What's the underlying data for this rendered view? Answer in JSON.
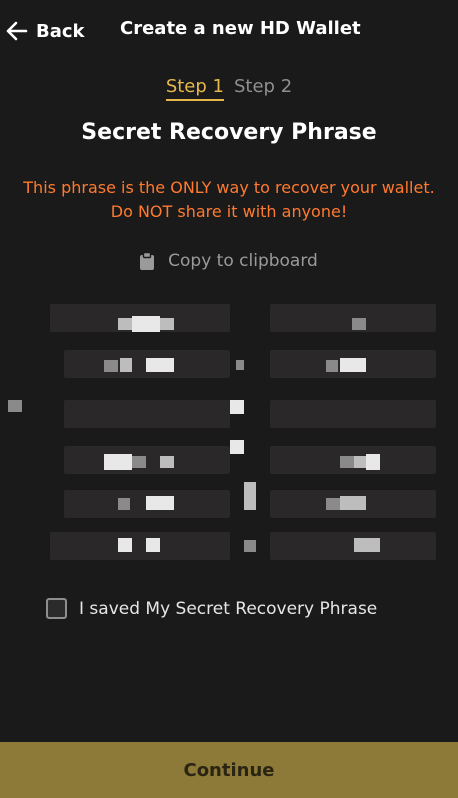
{
  "header": {
    "back_label": "Back",
    "title": "Create a new HD Wallet"
  },
  "steps": {
    "step1": "Step 1",
    "step2": "Step 2",
    "active": 1
  },
  "heading": "Secret Recovery Phrase",
  "warning": "This phrase is the ONLY way to recover your wallet. Do NOT share it with anyone!",
  "copy_label": "Copy to clipboard",
  "phrase_obscured": true,
  "checkbox": {
    "label": "I saved My Secret Recovery Phrase",
    "checked": false
  },
  "continue_label": "Continue",
  "colors": {
    "background": "#1b1a1a",
    "accent": "#e6b84c",
    "warning": "#ff7a2f",
    "button": "#8e7a38"
  }
}
